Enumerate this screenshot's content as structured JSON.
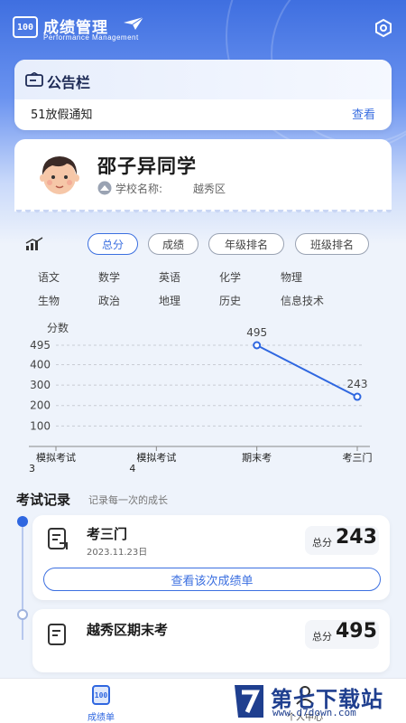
{
  "header": {
    "logo_text": "100",
    "title": "成绩管理",
    "subtitle": "Performance Management",
    "settings_icon": "settings-hexagon-icon",
    "plane_icon": "paper-plane-icon"
  },
  "notice": {
    "title": "公告栏",
    "icon": "notice-board-icon",
    "message": "51放假通知",
    "view_label": "查看"
  },
  "profile": {
    "name": "邵子异同学",
    "school_label": "学校名称:",
    "school_value": "越秀区",
    "avatar_icon": "student-avatar-icon"
  },
  "tabs": [
    {
      "label": "总分",
      "active": true
    },
    {
      "label": "成绩",
      "active": false
    },
    {
      "label": "年级排名",
      "active": false
    },
    {
      "label": "班级排名",
      "active": false
    }
  ],
  "subjects": [
    "语文",
    "数学",
    "英语",
    "化学",
    "物理",
    "生物",
    "政治",
    "地理",
    "历史",
    "信息技术"
  ],
  "chart_data": {
    "type": "line",
    "ylabel": "分数",
    "categories": [
      "模拟考试3",
      "模拟考试4",
      "期末考",
      "考三门"
    ],
    "category_lines": [
      [
        "模拟考试",
        "3"
      ],
      [
        "模拟考试",
        "4"
      ],
      [
        "期末考"
      ],
      [
        "考三门"
      ]
    ],
    "series": [
      {
        "values": [
          null,
          null,
          495,
          243
        ],
        "color": "#2f67e0"
      }
    ],
    "data_labels": [
      "495",
      "243"
    ],
    "yticks": [
      495,
      400,
      300,
      200,
      100
    ],
    "ylim": [
      0,
      495
    ],
    "grid": true
  },
  "records": {
    "title": "考试记录",
    "subtitle": "记录每一次的成长",
    "items": [
      {
        "name": "考三门",
        "date": "2023.11.23日",
        "score_label": "总分",
        "score": "243",
        "button": "查看该次成绩单"
      },
      {
        "name": "越秀区期末考",
        "date": "",
        "score_label": "总分",
        "score": "495",
        "button": ""
      }
    ]
  },
  "bottom_nav": [
    {
      "label": "成绩单",
      "icon": "report-card-icon",
      "active": true
    },
    {
      "label": "个人中心",
      "icon": "user-icon",
      "active": false
    }
  ],
  "watermark": {
    "main": "第七下载站",
    "url": "www.d7down.com"
  },
  "colors": {
    "accent": "#3b6fe0",
    "line": "#2f67e0",
    "header_bg": "#3f6fe0"
  }
}
